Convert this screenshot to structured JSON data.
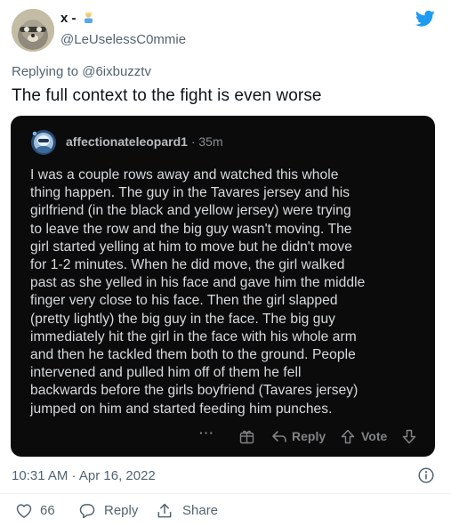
{
  "tweet": {
    "display_name": "x -",
    "handle": "@LeUselessC0mmie",
    "replying_prefix": "Replying to",
    "replying_to": "@6ixbuzztv",
    "text": "The full context to the fight is even worse",
    "timestamp": "10:31 AM · Apr 16, 2022",
    "likes": "66",
    "reply_label": "Reply",
    "share_label": "Share",
    "brand_color": "#1d9bf0"
  },
  "embedded_comment": {
    "username": "affectionateleopard1",
    "time": "· 35m",
    "body_lines": [
      "I was a couple rows away and watched this whole",
      "thing happen. The guy in the Tavares jersey and his",
      "girlfriend (in the black and yellow jersey) were trying",
      "to leave the row and the big guy wasn't moving. The",
      "girl started yelling at him to move but he didn't move",
      "for 1-2 minutes. When he did move, the girl walked",
      "past as she yelled in his face and gave him the middle",
      "finger very close to his face. Then the girl slapped",
      "(pretty lightly) the big guy in the face. The big guy",
      "immediately hit the girl in the face with his whole arm",
      "and then he tackled them both to the ground. People",
      "intervened and pulled him off of them he fell",
      "backwards before the girls boyfriend (Tavares jersey)",
      "jumped on him and started feeding him punches."
    ],
    "more_label": "···",
    "reply_label": "Reply",
    "vote_label": "Vote",
    "background": "#0b0b0c"
  }
}
